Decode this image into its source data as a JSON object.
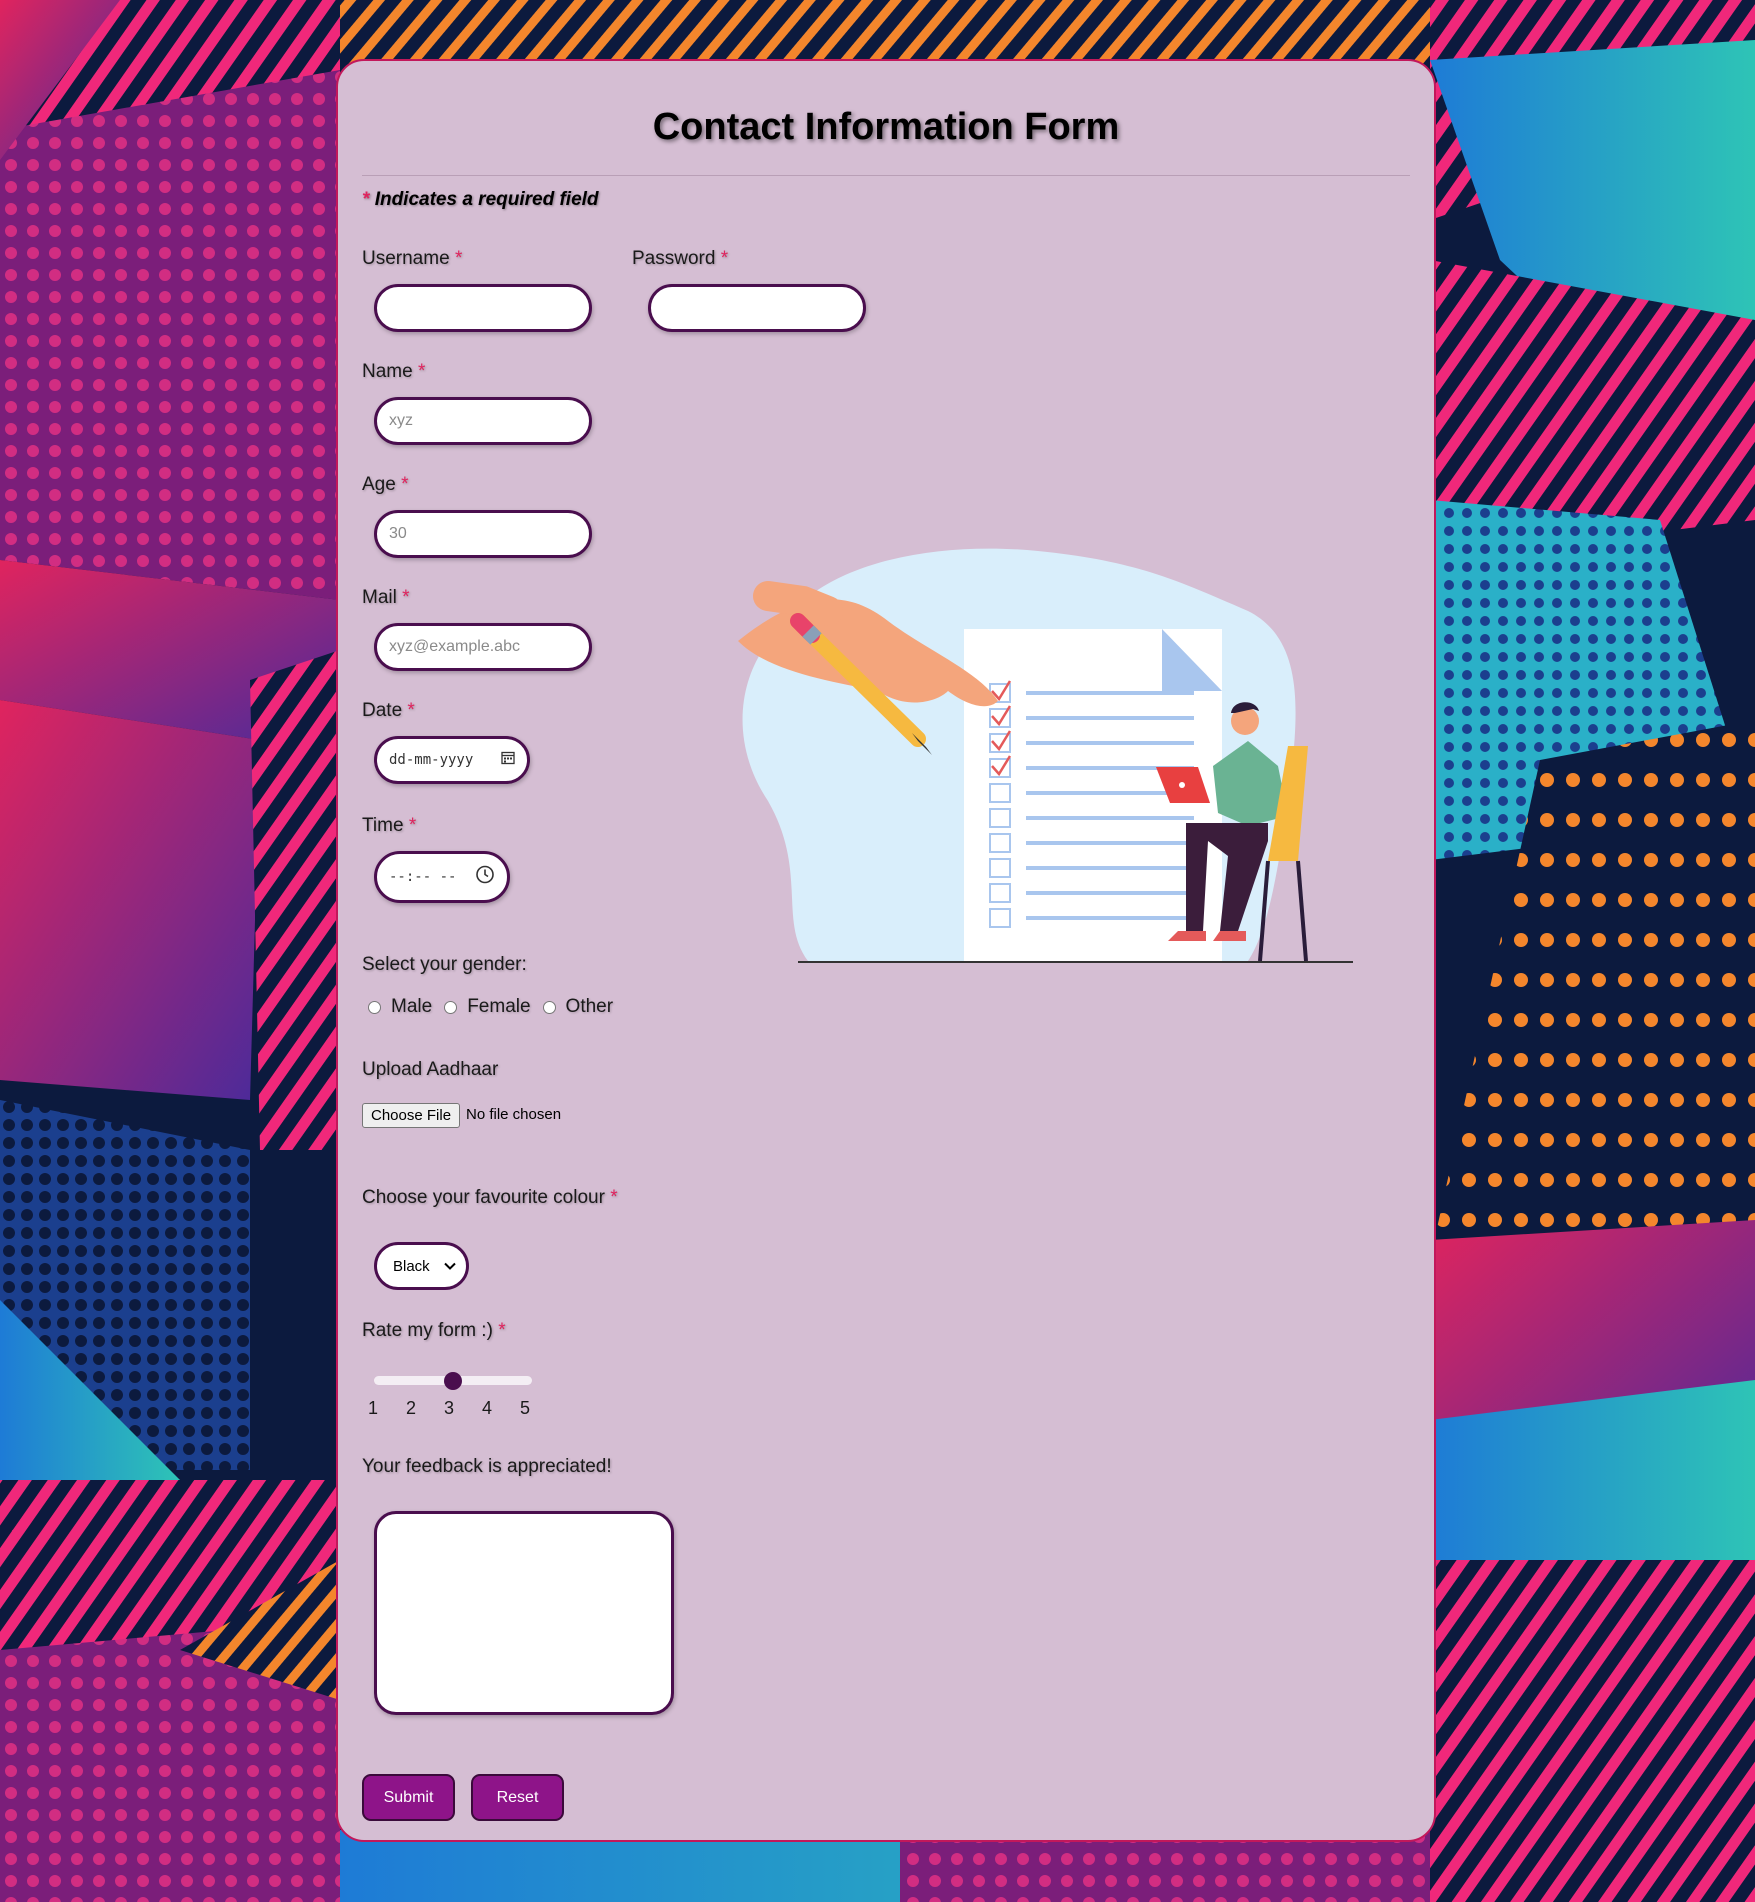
{
  "form": {
    "title": "Contact Information Form",
    "required_note": "Indicates a required field",
    "required_mark": "*"
  },
  "fields": {
    "username": {
      "label": "Username",
      "value": "",
      "placeholder": ""
    },
    "password": {
      "label": "Password",
      "value": "",
      "placeholder": ""
    },
    "name": {
      "label": "Name",
      "placeholder": "xyz"
    },
    "age": {
      "label": "Age",
      "placeholder": "30"
    },
    "mail": {
      "label": "Mail",
      "placeholder": "xyz@example.abc"
    },
    "date": {
      "label": "Date",
      "placeholder": "dd-mm-yyyy"
    },
    "time": {
      "label": "Time",
      "placeholder": "--:-- --"
    }
  },
  "gender": {
    "label": "Select your gender:",
    "options": [
      "Male",
      "Female",
      "Other"
    ]
  },
  "upload": {
    "label": "Upload Aadhaar",
    "button": "Choose File",
    "status": "No file chosen"
  },
  "colour": {
    "label": "Choose your favourite colour",
    "selected": "Black"
  },
  "rating": {
    "label": "Rate my form :)",
    "ticks": [
      "1",
      "2",
      "3",
      "4",
      "5"
    ],
    "value": 3,
    "min": 1,
    "max": 5
  },
  "feedback": {
    "label": "Your feedback is appreciated!",
    "value": ""
  },
  "actions": {
    "submit": "Submit",
    "reset": "Reset"
  },
  "colors": {
    "card_bg": "#d5bed3",
    "card_border": "#c2185b",
    "input_border": "#4a0e4e",
    "button_bg": "#8e1489",
    "required": "#e0245e"
  },
  "icons": {
    "date": "calendar-icon",
    "time": "clock-icon",
    "select": "chevron-down-icon"
  }
}
